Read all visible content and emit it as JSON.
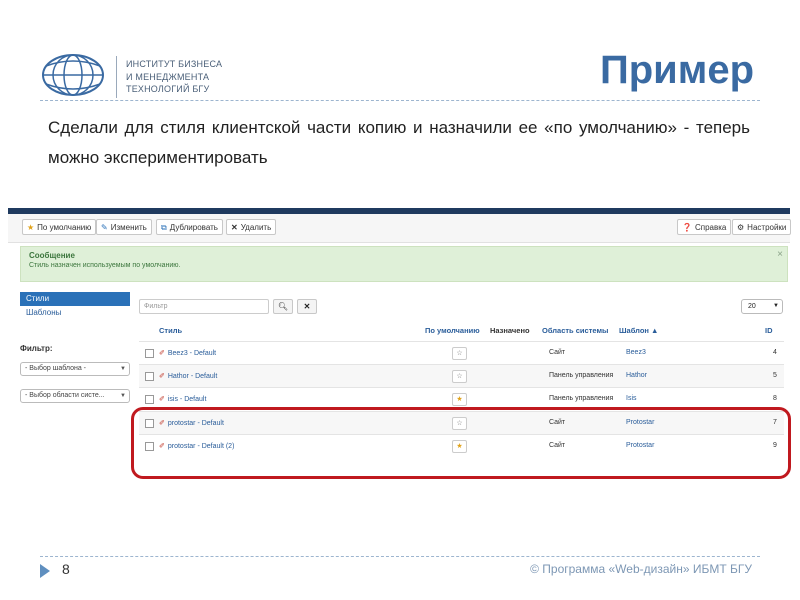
{
  "slide": {
    "logo_text": [
      "ИНСТИТУТ БИЗНЕСА",
      "И МЕНЕДЖМЕНТА",
      "ТЕХНОЛОГИЙ БГУ"
    ],
    "title": "Пример",
    "body": "Сделали для стиля клиентской части копию и назначили ее «по умолчанию» - теперь можно экспериментировать",
    "page_number": "8",
    "copyright": "© Программа «Web-дизайн» ИБМТ БГУ"
  },
  "toolbar": {
    "default_label": "По умолчанию",
    "edit_label": "Изменить",
    "duplicate_label": "Дублировать",
    "delete_label": "Удалить",
    "help_label": "Справка",
    "settings_label": "Настройки"
  },
  "message": {
    "title": "Сообщение",
    "text": "Стиль назначен используемым по умолчанию.",
    "close": "×"
  },
  "sidebar": {
    "items": [
      {
        "label": "Стили",
        "active": true
      },
      {
        "label": "Шаблоны",
        "active": false
      }
    ],
    "filter_label": "Фильтр:",
    "template_select": "- Выбор шаблона -",
    "area_select": "- Выбор области систе..."
  },
  "search": {
    "placeholder": "Фильтр",
    "limit": "20"
  },
  "table": {
    "columns": {
      "style": "Стиль",
      "default": "По умолчанию",
      "assigned": "Назначено",
      "area": "Область системы",
      "template": "Шаблон ▲",
      "id": "ID"
    },
    "rows": [
      {
        "style": "Beez3 - Default",
        "default": false,
        "area": "Сайт",
        "template": "Beez3",
        "id": "4"
      },
      {
        "style": "Hathor - Default",
        "default": false,
        "area": "Панель управления",
        "template": "Hathor",
        "id": "5"
      },
      {
        "style": "isis - Default",
        "default": true,
        "area": "Панель управления",
        "template": "Isis",
        "id": "8"
      },
      {
        "style": "protostar - Default",
        "default": false,
        "area": "Сайт",
        "template": "Protostar",
        "id": "7"
      },
      {
        "style": "protostar - Default (2)",
        "default": true,
        "area": "Сайт",
        "template": "Protostar",
        "id": "9"
      }
    ]
  },
  "colors": {
    "accent": "#2a71b8",
    "title": "#3a6aa2",
    "highlight": "#c0191f",
    "message_bg": "#dff0d8"
  }
}
